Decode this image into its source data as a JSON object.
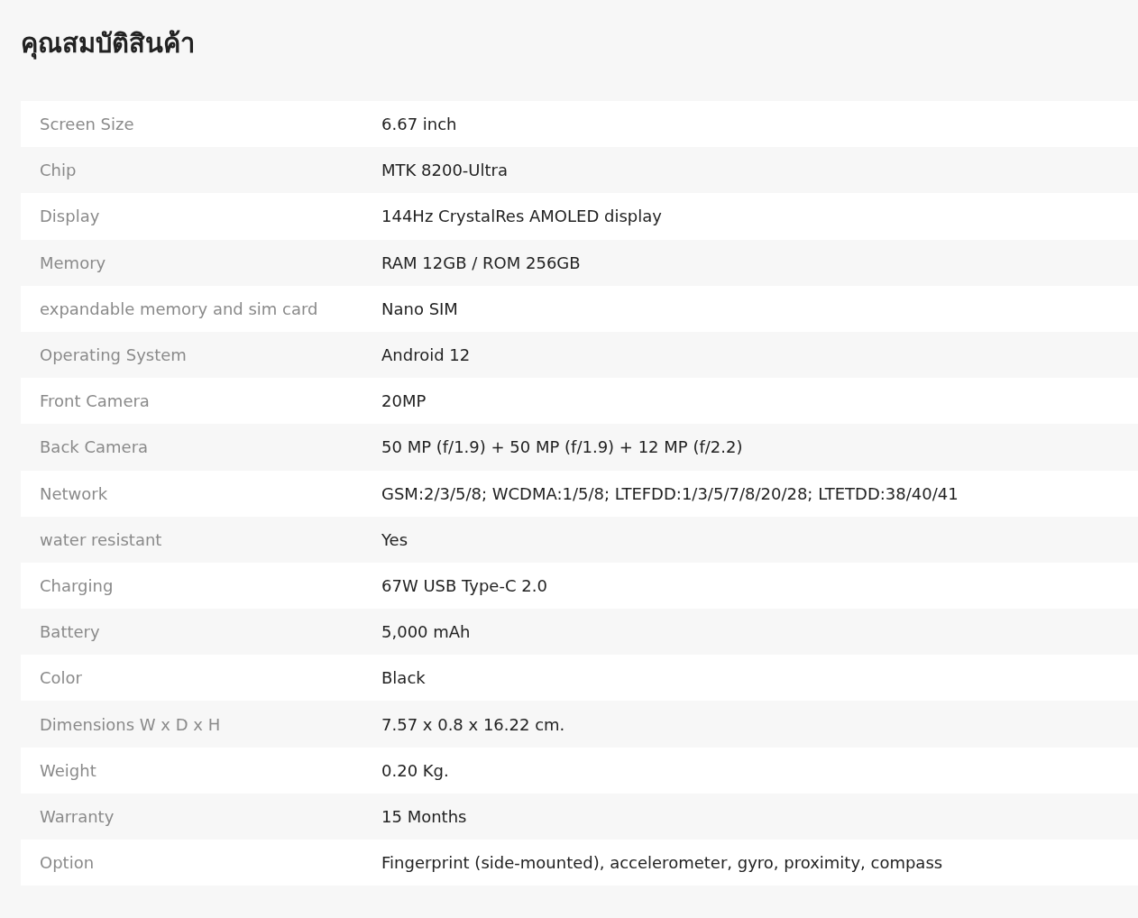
{
  "title": "คุณสมบัติสินค้า",
  "specs": [
    {
      "label": "Screen Size",
      "value": "6.67 inch"
    },
    {
      "label": "Chip",
      "value": "MTK 8200-Ultra"
    },
    {
      "label": "Display",
      "value": "144Hz CrystalRes AMOLED display"
    },
    {
      "label": "Memory",
      "value": "RAM 12GB / ROM 256GB"
    },
    {
      "label": "expandable memory and sim card",
      "value": "Nano SIM"
    },
    {
      "label": "Operating System",
      "value": "Android 12"
    },
    {
      "label": "Front Camera",
      "value": "20MP"
    },
    {
      "label": "Back Camera",
      "value": "50 MP (f/1.9) + 50 MP (f/1.9) + 12 MP (f/2.2)"
    },
    {
      "label": "Network",
      "value": "GSM:2/3/5/8; WCDMA:1/5/8; LTEFDD:1/3/5/7/8/20/28; LTETDD:38/40/41"
    },
    {
      "label": "water resistant",
      "value": "Yes"
    },
    {
      "label": "Charging",
      "value": "67W USB Type-C 2.0"
    },
    {
      "label": "Battery",
      "value": "5,000 mAh"
    },
    {
      "label": "Color",
      "value": "Black"
    },
    {
      "label": "Dimensions W x D x H",
      "value": "7.57 x 0.8 x 16.22 cm."
    },
    {
      "label": "Weight",
      "value": "0.20 Kg."
    },
    {
      "label": "Warranty",
      "value": "15 Months"
    },
    {
      "label": "Option",
      "value": "Fingerprint (side-mounted), accelerometer, gyro, proximity, compass"
    }
  ]
}
